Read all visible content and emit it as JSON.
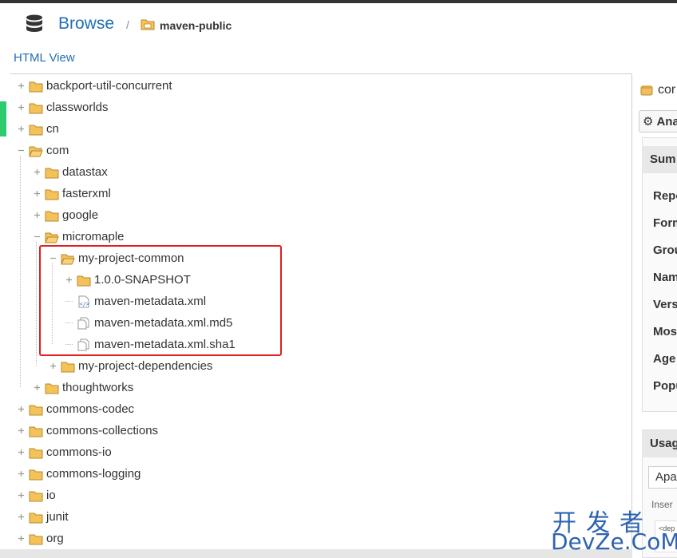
{
  "header": {
    "title": "Browse",
    "separator": "/",
    "repository": "maven-public"
  },
  "view_link": "HTML View",
  "tree": [
    {
      "label": "backport-util-concurrent",
      "type": "folder",
      "depth": 0,
      "toggle": "+"
    },
    {
      "label": "classworlds",
      "type": "folder",
      "depth": 0,
      "toggle": "+"
    },
    {
      "label": "cn",
      "type": "folder",
      "depth": 0,
      "toggle": "+"
    },
    {
      "label": "com",
      "type": "folder-open",
      "depth": 0,
      "toggle": "-"
    },
    {
      "label": "datastax",
      "type": "folder",
      "depth": 1,
      "toggle": "+"
    },
    {
      "label": "fasterxml",
      "type": "folder",
      "depth": 1,
      "toggle": "+"
    },
    {
      "label": "google",
      "type": "folder",
      "depth": 1,
      "toggle": "+"
    },
    {
      "label": "micromaple",
      "type": "folder-open",
      "depth": 1,
      "toggle": "-"
    },
    {
      "label": "my-project-common",
      "type": "folder-open",
      "depth": 2,
      "toggle": "-"
    },
    {
      "label": "1.0.0-SNAPSHOT",
      "type": "folder",
      "depth": 3,
      "toggle": "+"
    },
    {
      "label": "maven-metadata.xml",
      "type": "xml",
      "depth": 3,
      "toggle": ""
    },
    {
      "label": "maven-metadata.xml.md5",
      "type": "file",
      "depth": 3,
      "toggle": ""
    },
    {
      "label": "maven-metadata.xml.sha1",
      "type": "file",
      "depth": 3,
      "toggle": ""
    },
    {
      "label": "my-project-dependencies",
      "type": "folder",
      "depth": 2,
      "toggle": "+"
    },
    {
      "label": "thoughtworks",
      "type": "folder",
      "depth": 1,
      "toggle": "+"
    },
    {
      "label": "commons-codec",
      "type": "folder",
      "depth": 0,
      "toggle": "+"
    },
    {
      "label": "commons-collections",
      "type": "folder",
      "depth": 0,
      "toggle": "+"
    },
    {
      "label": "commons-io",
      "type": "folder",
      "depth": 0,
      "toggle": "+"
    },
    {
      "label": "commons-logging",
      "type": "folder",
      "depth": 0,
      "toggle": "+"
    },
    {
      "label": "io",
      "type": "folder",
      "depth": 0,
      "toggle": "+"
    },
    {
      "label": "junit",
      "type": "folder",
      "depth": 0,
      "toggle": "+"
    },
    {
      "label": "org",
      "type": "folder",
      "depth": 0,
      "toggle": "+"
    }
  ],
  "right_panel": {
    "component_label": "cor",
    "analyze_label": "Ana",
    "summary_header": "Sum",
    "fields": [
      "Repo",
      "Form",
      "Grou",
      "Nam",
      "Vers",
      "Mos",
      "Age",
      "Popu"
    ],
    "usage_header": "Usag",
    "usage_select": "Apa",
    "insert_label": "Inser",
    "code_snippet": "<dep"
  },
  "watermark": {
    "cn": "开发者",
    "en": "DevZe.CoM"
  },
  "colors": {
    "link": "#1f6fb5",
    "highlight": "#e02020",
    "accent": "#2ecc71",
    "folder": "#f5c25a"
  }
}
